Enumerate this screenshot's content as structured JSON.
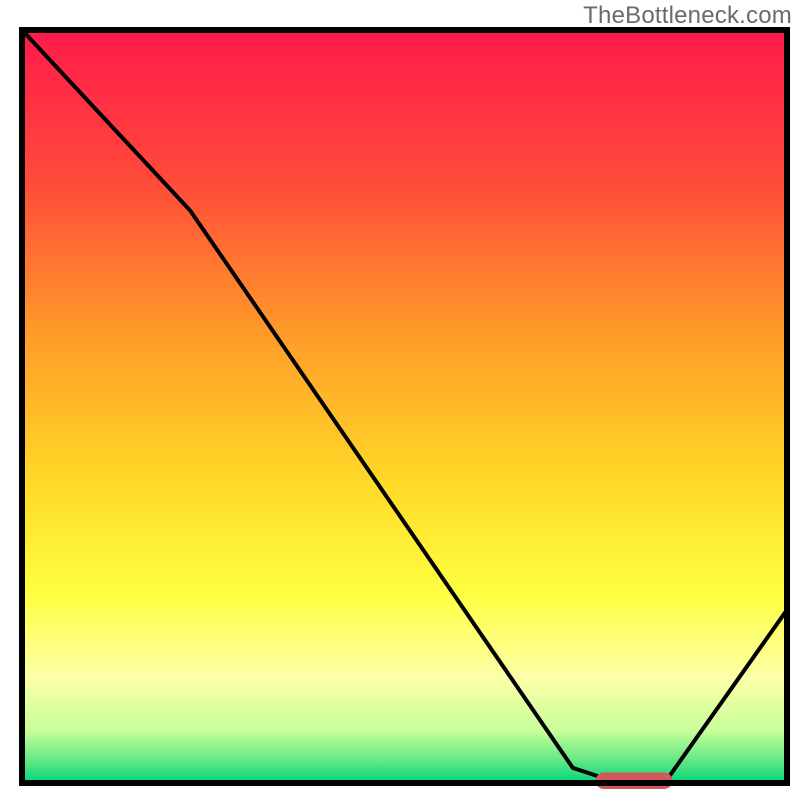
{
  "watermark": "TheBottleneck.com",
  "chart_data": {
    "type": "line",
    "title": "",
    "xlabel": "",
    "ylabel": "",
    "xlim": [
      0,
      100
    ],
    "ylim": [
      0,
      100
    ],
    "background_gradient": {
      "stops": [
        {
          "offset": 0.0,
          "color": "#ff1a4b"
        },
        {
          "offset": 0.2,
          "color": "#ff4a3a"
        },
        {
          "offset": 0.4,
          "color": "#ff9a2a"
        },
        {
          "offset": 0.6,
          "color": "#ffd927"
        },
        {
          "offset": 0.75,
          "color": "#ffff41"
        },
        {
          "offset": 0.86,
          "color": "#fcffa7"
        },
        {
          "offset": 0.93,
          "color": "#c8ff9a"
        },
        {
          "offset": 0.97,
          "color": "#63e884"
        },
        {
          "offset": 1.0,
          "color": "#00d67a"
        }
      ]
    },
    "series": [
      {
        "name": "curve",
        "color": "#000000",
        "points": [
          {
            "x": 0,
            "y": 100
          },
          {
            "x": 22,
            "y": 76
          },
          {
            "x": 72,
            "y": 2
          },
          {
            "x": 78,
            "y": 0
          },
          {
            "x": 84,
            "y": 0
          },
          {
            "x": 100,
            "y": 23
          }
        ]
      }
    ],
    "marker": {
      "color": "#d05a5a",
      "x_start": 75,
      "x_end": 85,
      "y": 0.3,
      "thickness": 2.2
    },
    "plot_frame": {
      "stroke": "#000000",
      "stroke_width": 6
    }
  }
}
